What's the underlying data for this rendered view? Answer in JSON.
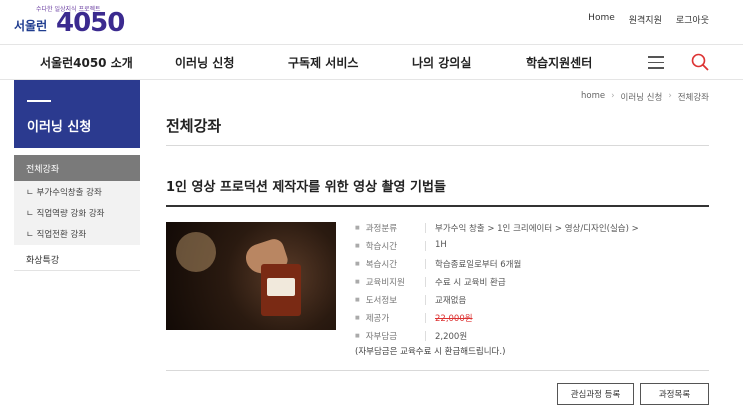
{
  "logo": {
    "tagline": "수다한 일상지식 프로젝트",
    "seoul": "서울런",
    "number": "4050"
  },
  "util": {
    "home": "Home",
    "remote": "원격지원",
    "logout": "로그아웃"
  },
  "gnb": [
    "서울런4050 소개",
    "이러닝 신청",
    "구독제 서비스",
    "나의 강의실",
    "학습지원센터"
  ],
  "sidebar": {
    "title": "이러닝 신청",
    "active": "전체강좌",
    "sub": [
      "ㄴ 부가수익창출 강좌",
      "ㄴ 직업역량 강화 강좌",
      "ㄴ 직업전환 강좌"
    ],
    "other": "화상특강"
  },
  "breadcrumb": {
    "home": "home",
    "level1": "이러닝 신청",
    "level2": "전체강좌"
  },
  "page_title": "전체강좌",
  "course": {
    "title": "1인 영상 프로덕션 제작자를 위한 영상 촬영 기법들",
    "info": [
      {
        "key": "과정분류",
        "value": "부가수익 창출 > 1인 크리에이터 > 영상/디자인(실습) >"
      },
      {
        "key": "학습시간",
        "value": "1H"
      },
      {
        "key": "복습시간",
        "value": "학습종료일로부터 6개월"
      },
      {
        "key": "교육비지원",
        "value": "수료 시 교육비 환급"
      },
      {
        "key": "도서정보",
        "value": "교재없음"
      },
      {
        "key": "제공가",
        "value": "22,000원"
      },
      {
        "key": "자부담금",
        "value": "2,200원"
      }
    ],
    "note": "(자부담금은 교육수료 시 환급해드립니다.)"
  },
  "buttons": {
    "interest": "관심과정 등록",
    "list": "과정목록"
  },
  "colors": {
    "brand_navy": "#2b3a8f",
    "price_strike": "#d33333"
  }
}
